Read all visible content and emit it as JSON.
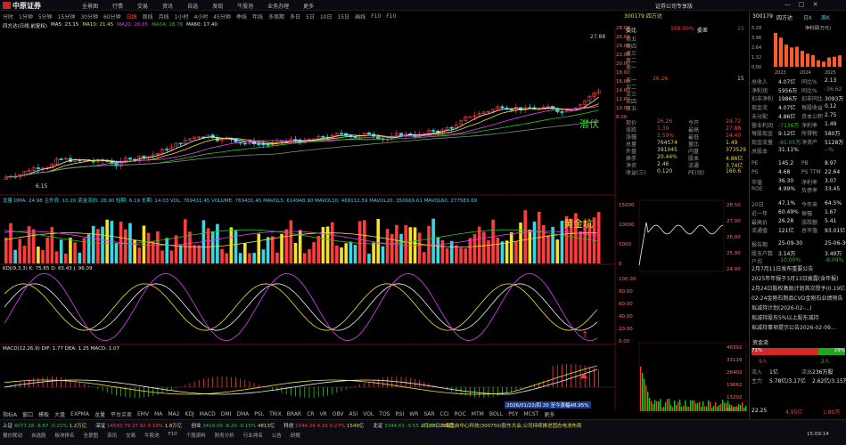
{
  "app": {
    "logo_text": "中原证券",
    "menu": [
      "全景图",
      "行情",
      "交易",
      "资讯",
      "自选",
      "发现",
      "牛股池",
      "业务办理",
      "更多"
    ],
    "top_right": "证券公司专享版",
    "window_controls": [
      "—",
      "□",
      "✕"
    ]
  },
  "period_bar": {
    "items": [
      "分时",
      "1分钟",
      "5分钟",
      "15分钟",
      "30分钟",
      "60分钟",
      "日线",
      "周线",
      "月线",
      "1小时",
      "4小时",
      "45分钟",
      "季线",
      "年线",
      "多周期",
      "多日",
      "5日",
      "10日",
      "15日",
      "画线",
      "F10",
      "F10"
    ],
    "active_index": 6
  },
  "chart_title": {
    "name": "四方达(日线,前复权)",
    "ma_label": "MA5: 23.15",
    "ma10": "MA10: 21.45",
    "ma20": "MA20: 20.65",
    "ma34": "MA34: 18.76",
    "ma60": "MA60: 17.40"
  },
  "price_chart": {
    "high_label": "27.88",
    "low_label": "6.15",
    "annotation": "潜伏",
    "y_ticks": [
      "28.00",
      "26.00",
      "24.00",
      "22.00",
      "20.00",
      "18.00",
      "16.00",
      "14.00",
      "12.00",
      "10.00",
      "8.00"
    ]
  },
  "indicator1": {
    "legend": "龙量 DMA: 24.98  主升浪: 10.20  资金流向: 28.90  短期: 6.19  长期: 14.03  VOL: 769431.45  VOLUME: 769431.45  MAVOL5: 614948.90  MAVOL10: 469112.59  MAVOL20: 350669.61  MAVOL60: 277583.69",
    "annotation": "黄金坑",
    "y_ticks": [
      "15000",
      "10000",
      "5000"
    ]
  },
  "kdj": {
    "legend": "KDJ(9,3,3)  K: 75.65  D: 65.43  J: 96.09",
    "y_ticks": [
      "100.00",
      "80.00",
      "60.00",
      "40.00",
      "20.00",
      "0.00"
    ]
  },
  "macd": {
    "legend": "MACD(12,26,9)  DIF: 1.77  DEA: 1.25  MACD: 1.07",
    "y_ticks": [
      "2.00",
      "1.00",
      "0.00",
      "-1.00"
    ]
  },
  "bottom_tabs": [
    "指标A",
    "窗口",
    "模板",
    "大盘",
    "EXPMA",
    "龙量",
    "平台买卖",
    "EMV",
    "MA",
    "MA2",
    "KDJ",
    "MACD",
    "DMI",
    "DMA",
    "PSL",
    "TRIX",
    "BRAR",
    "CR",
    "VR",
    "OBV",
    "ASI",
    "VOL",
    "TOS",
    "RSI",
    "WR",
    "SAR",
    "CCI",
    "ROC",
    "MTM",
    "BOLL",
    "PSY",
    "MCST",
    "更多"
  ],
  "date_flag": "2026/01/22/四 20 至今涨幅48.95%",
  "orderbook": {
    "code": "300179",
    "name": "四方达",
    "weibi_label": "委比",
    "weibi": "100.00%",
    "weicha_label": "委差",
    "weicha": "15",
    "sells": [
      {
        "label": "卖五",
        "price": "",
        "vol": ""
      },
      {
        "label": "卖四",
        "price": "",
        "vol": ""
      },
      {
        "label": "卖三",
        "price": "",
        "vol": ""
      },
      {
        "label": "卖二",
        "price": "",
        "vol": ""
      },
      {
        "label": "卖一",
        "price": "",
        "vol": ""
      }
    ],
    "buys": [
      {
        "label": "买一",
        "price": "26.26",
        "vol": "15"
      },
      {
        "label": "买二",
        "price": "",
        "vol": ""
      },
      {
        "label": "买三",
        "price": "",
        "vol": ""
      },
      {
        "label": "买四",
        "price": "",
        "vol": ""
      },
      {
        "label": "买五",
        "price": "",
        "vol": ""
      }
    ]
  },
  "quote": {
    "rows": [
      {
        "k1": "现价",
        "v1": "26.26",
        "k2": "今开",
        "v2": "24.72"
      },
      {
        "k1": "涨跌",
        "v1": "1.39",
        "k2": "最高",
        "v2": "27.88"
      },
      {
        "k1": "涨幅",
        "v1": "5.59%",
        "k2": "最低",
        "v2": "24.40"
      },
      {
        "k1": "总量",
        "v1": "764574",
        "k2": "量比",
        "v2": "1.49"
      },
      {
        "k1": "外盘",
        "v1": "391045",
        "k2": "内盘",
        "v2": "373529"
      },
      {
        "k1": "换手",
        "v1": "20.44%",
        "k2": "股本",
        "v2": "4.86亿"
      },
      {
        "k1": "净资",
        "v1": "2.46",
        "k2": "流通",
        "v2": "3.74亿"
      },
      {
        "k1": "收益(三)",
        "v1": "0.120",
        "k2": "PE(动)",
        "v2": "160.6"
      }
    ]
  },
  "right_panel": {
    "code": "300179",
    "name": "四方达",
    "tags": [
      "日K",
      "周K"
    ],
    "bar_title": "净利润(万元)",
    "bar_years": [
      "2023",
      "2024",
      "2025"
    ],
    "bar_values": [
      9800,
      8400,
      6400,
      5600,
      5800,
      4600,
      3800,
      3400,
      1900,
      1500,
      2700,
      2900,
      3300
    ],
    "y_ticks": [
      "5.28",
      "3.96",
      "2.64",
      "1.32",
      "0.00"
    ],
    "stats": [
      {
        "k": "总收入",
        "v": "4.07亿",
        "k2": "同比%",
        "v2": "2.13"
      },
      {
        "k": "净利润",
        "v": "5956万",
        "k2": "同比%",
        "v2": "-36.62"
      },
      {
        "k": "扣非净利",
        "v": "1986万",
        "k2": "扣非同比",
        "v2": "3093万"
      },
      {
        "k": "现金流",
        "v": "4.07亿",
        "k2": "每股收益",
        "v2": "0.12"
      },
      {
        "k": "未分配",
        "v": "4.86亿",
        "k2": "资本公积",
        "v2": "2.75"
      },
      {
        "k": "营业利润",
        "v": "-7136万",
        "k2": "净利率",
        "v2": "1.49"
      },
      {
        "k": "每股现金",
        "v": "9.12亿",
        "k2": "所得税",
        "v2": "580万"
      },
      {
        "k": "现金流量",
        "v": "-91.05万",
        "k2": "净资产",
        "v2": "5128万"
      },
      {
        "k": "总股本",
        "v": "31.11%",
        "k2": "",
        "v2": "--%"
      },
      {
        "k": "PE",
        "v": "145.2",
        "k2": "PB",
        "v2": "8.97"
      },
      {
        "k": "PS",
        "v": "4.68",
        "k2": "PS TTM",
        "v2": "22.64"
      },
      {
        "k": "市值",
        "v": "36.30",
        "k2": "净利率",
        "v2": "3.07"
      },
      {
        "k": "ROE",
        "v": "4.99%",
        "k2": "负债率",
        "v2": "33.45"
      },
      {
        "k": "20日",
        "v": "47.1%",
        "k2": "今年来",
        "v2": "64.5%"
      },
      {
        "k": "近一年",
        "v": "60.49%",
        "k2": "振幅",
        "v2": "1.67"
      },
      {
        "k": "最高价",
        "v": "26.28",
        "k2": "涨跌额",
        "v2": "5.41"
      },
      {
        "k": "流通值",
        "v": "121亿",
        "k2": "总市值",
        "v2": "93.01亿"
      },
      {
        "k": "报告期",
        "v": "25-09-30",
        "k2": "",
        "v2": "25-06-30"
      },
      {
        "k": "股东户数",
        "v": "3.14万",
        "k2": "",
        "v2": "3.49万"
      },
      {
        "k": "户均",
        "v": "-10.00%",
        "k2": "",
        "v2": "-8.09%"
      }
    ],
    "news": [
      "2月7月11日发布重要公告",
      "2025年年报于3月13日披露(含年报)",
      "2月24日股权激励计划首次授予(0.19亿)",
      "02-24金刚石制品CVD金刚石业绩预告",
      "拟减持计划(2026-02-...)",
      "拟减持股东5%以上股东减持",
      "拟减持事项提示公告2026-02-09..."
    ],
    "flow_label": "资金流",
    "flow_big": "71%",
    "flow_small": "29%",
    "flow_in_label": "9人",
    "flow_out_label": "2人",
    "bottom_rows": [
      {
        "k": "流入",
        "v": "1亿",
        "k2": "流出",
        "v2": "236万股"
      },
      {
        "k": "主力",
        "v": "5.78亿/3.17亿",
        "k2": "",
        "v2": "2.62亿/3.15万"
      }
    ],
    "last_row": {
      "k": "22.25",
      "v": "4.95亿",
      "k2": "",
      "v2": "1.80万"
    }
  },
  "minichart": {
    "y_ticks": [
      "15000",
      "10000",
      "5000",
      "0"
    ],
    "price_ticks": [
      "28.50",
      "27.00",
      "26.00",
      "25.00",
      "24.00"
    ]
  },
  "volume_ticks": [
    "46392",
    "33116",
    "26402",
    "19662",
    "13202",
    "6623"
  ],
  "statusbar": {
    "tickers": [
      {
        "name": "上证",
        "val": "4077.28",
        "chg": "-8.67",
        "pct": "-0.21%",
        "amt": "1.2万亿",
        "cls": "dn"
      },
      {
        "name": "深证",
        "val": "14583.79",
        "chg": "27.92",
        "pct": "0.19%",
        "amt": "1.8万亿",
        "cls": "up"
      },
      {
        "name": "创业",
        "val": "3419.09",
        "chg": "-8.20",
        "pct": "-0.15%",
        "amt": "4813亿",
        "cls": "dn"
      },
      {
        "name": "科创",
        "val": "1544.26",
        "chg": "4.16",
        "pct": "0.27%",
        "amt": "1549亿",
        "cls": "up"
      },
      {
        "name": "北证",
        "val": "3344.63",
        "chg": "-9.55",
        "pct": "-0.29%",
        "amt": "295亿",
        "cls": "dn"
      }
    ],
    "news_ticker": "2月23日上海重启中心科技(300750)股东大会,公司持续推进固态电池布局",
    "time": "15:09:14",
    "second_row": [
      "报价联动",
      "自选股",
      "板块排名",
      "全景图",
      "资讯",
      "交易",
      "牛股池",
      "F10",
      "个股资料",
      "财务分析",
      "行业排名",
      "公告",
      "研报"
    ]
  }
}
